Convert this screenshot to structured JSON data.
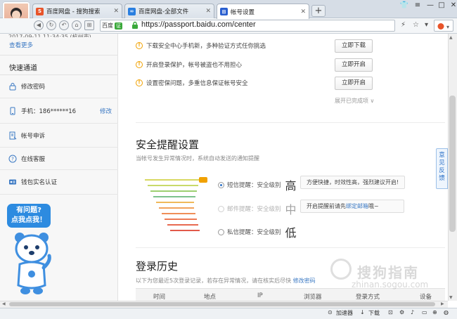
{
  "browser": {
    "tabs": [
      {
        "label": "百度网盘 - 搜狗搜索",
        "fav_color": "#e8542a",
        "fav_glyph": "S"
      },
      {
        "label": "百度网盘-全部文件",
        "fav_color": "#2a7fe0",
        "fav_glyph": "∞"
      },
      {
        "label": "帐号设置",
        "fav_color": "#2a5fd0",
        "fav_glyph": "⊞"
      }
    ],
    "url": "https://passport.baidu.com/center",
    "site_brand": "百度",
    "site_badge": "证"
  },
  "sidebar": {
    "timestamp_partial": "2017-09-11 11:34:35  (杭州市)",
    "view_more": "查看更多",
    "quick_title": "快速通道",
    "items": [
      {
        "label": "修改密码",
        "icon": "lock-icon"
      },
      {
        "label": "手机：186******16",
        "icon": "phone-icon",
        "action": "修改"
      },
      {
        "label": "帐号申诉",
        "icon": "appeal-icon"
      },
      {
        "label": "在线客服",
        "icon": "help-icon"
      },
      {
        "label": "钱包实名认证",
        "icon": "id-card-icon"
      }
    ],
    "mascot_line1": "有问题?",
    "mascot_line2": "点我点我！"
  },
  "security": {
    "tips": [
      {
        "text": "下载安全中心手机新，多种验证方式任你挑选",
        "button": "立即下载"
      },
      {
        "text": "开启登录保护，帐号被盗也不用担心",
        "button": "立即开启"
      },
      {
        "text": "设置密保问题，多重信息保证帐号安全",
        "button": "立即开启"
      }
    ],
    "expand_label": "展开已完成项 ∨"
  },
  "alerts": {
    "title": "安全提醒设置",
    "subtitle": "当帐号发生异常情况时，系统自动发送的通知提醒",
    "levels": [
      {
        "label": "短信提醒：安全级别",
        "level": "高",
        "tip": "方便快捷，时效性高，强烈建议开启!",
        "selected": true,
        "dim": false
      },
      {
        "label": "邮件提醒：安全级别",
        "level": "中",
        "tip_prefix": "开启提醒前请先",
        "tip_link": "绑定邮箱",
        "tip_suffix": "哦~",
        "selected": false,
        "dim": true
      },
      {
        "label": "私信提醒：安全级别",
        "level": "低",
        "selected": false,
        "dim": false
      }
    ]
  },
  "history": {
    "title": "登录历史",
    "subtitle": "以下为您最近5次登录记录，若存在异常情况，请在核实后尽快",
    "subtitle_link": "修改密码",
    "columns": [
      "时间",
      "地点",
      "IP",
      "浏览器",
      "登录方式",
      "设备"
    ]
  },
  "feedback": "意见反馈",
  "statusbar": {
    "accelerator": "加速器",
    "download": "下载"
  },
  "watermark": {
    "text": "搜狗指南",
    "url": "zhinan.sogou.com"
  }
}
